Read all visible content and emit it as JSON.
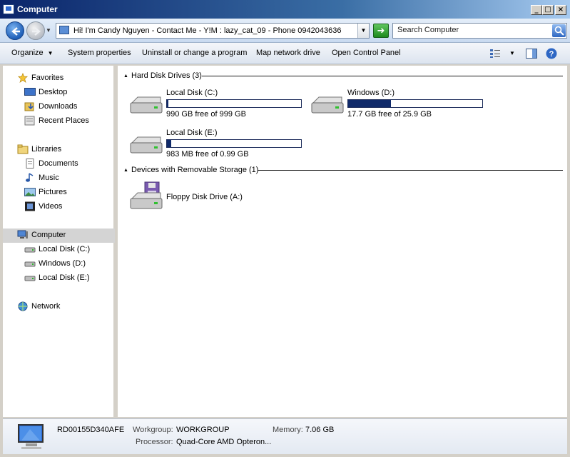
{
  "window": {
    "title": "Computer",
    "minimize": "_",
    "maximize": "□",
    "close": "×"
  },
  "address": {
    "path": "Hi! I'm Candy Nguyen - Contact Me - Y!M : lazy_cat_09 - Phone 0942043636"
  },
  "search": {
    "placeholder": "Search Computer"
  },
  "toolbar": {
    "organize": "Organize",
    "system_properties": "System properties",
    "uninstall": "Uninstall or change a program",
    "map_drive": "Map network drive",
    "control_panel": "Open Control Panel"
  },
  "nav": {
    "favorites": "Favorites",
    "desktop": "Desktop",
    "downloads": "Downloads",
    "recent": "Recent Places",
    "libraries": "Libraries",
    "documents": "Documents",
    "music": "Music",
    "pictures": "Pictures",
    "videos": "Videos",
    "computer": "Computer",
    "local_c": "Local Disk (C:)",
    "windows_d": "Windows (D:)",
    "local_e": "Local Disk (E:)",
    "network": "Network"
  },
  "groups": {
    "hdd": "Hard Disk Drives (3)",
    "removable": "Devices with Removable Storage (1)"
  },
  "drives": [
    {
      "name": "Local Disk (C:)",
      "free": "990 GB free of 999 GB",
      "used_fraction": 0.01
    },
    {
      "name": "Windows (D:)",
      "free": "17.7 GB free of 25.9 GB",
      "used_fraction": 0.32
    },
    {
      "name": "Local Disk (E:)",
      "free": "983 MB free of 0.99 GB",
      "used_fraction": 0.03
    }
  ],
  "removable": {
    "name": "Floppy Disk Drive (A:)"
  },
  "details": {
    "computer_name": "RD00155D340AFE",
    "workgroup_label": "Workgroup:",
    "workgroup_value": "WORKGROUP",
    "memory_label": "Memory:",
    "memory_value": "7.06 GB",
    "processor_label": "Processor:",
    "processor_value": "Quad-Core AMD Opteron..."
  }
}
